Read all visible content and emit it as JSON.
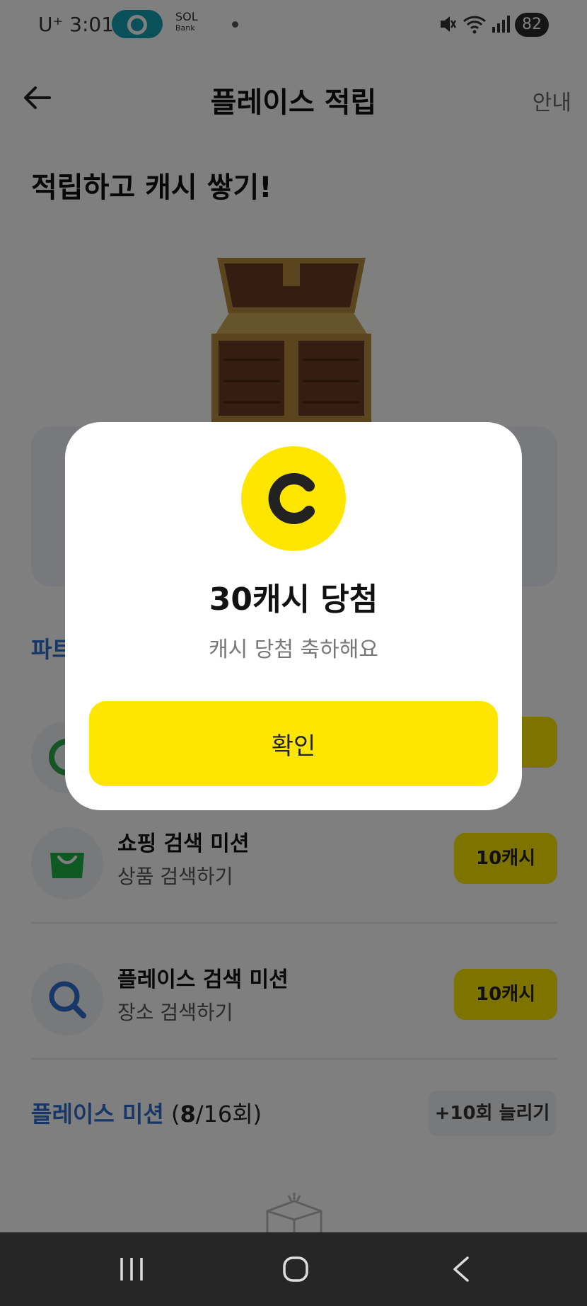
{
  "status_bar": {
    "carrier": "U⁺ 3:01",
    "sol_label": "SOL",
    "sol_sub": "Bank",
    "battery": "82",
    "icons": [
      "mute-icon",
      "wifi-icon",
      "signal-icon"
    ]
  },
  "header": {
    "title": "플레이스 적립",
    "guide": "안내"
  },
  "headline": "적립하고 캐시 쌓기!",
  "partner_section_title": "파트",
  "missions": [
    {
      "title": "쇼핑 검색 미션",
      "subtitle": "상품 검색하기",
      "reward": "10캐시",
      "icon": "shopping-bag-icon"
    },
    {
      "title": "플레이스 검색 미션",
      "subtitle": "장소 검색하기",
      "reward": "10캐시",
      "icon": "search-icon"
    }
  ],
  "place_mission": {
    "title": "플레이스 미션",
    "count_open": " (",
    "count_done": "8",
    "count_rest": "/16회)",
    "extend_label": "+10회 늘리기"
  },
  "modal": {
    "title": "30캐시 당첨",
    "subtitle": "캐시 당첨 축하해요",
    "confirm_label": "확인"
  },
  "colors": {
    "accent_yellow": "#ffe600",
    "link_blue": "#2d6fd1",
    "navbar": "#262626"
  }
}
